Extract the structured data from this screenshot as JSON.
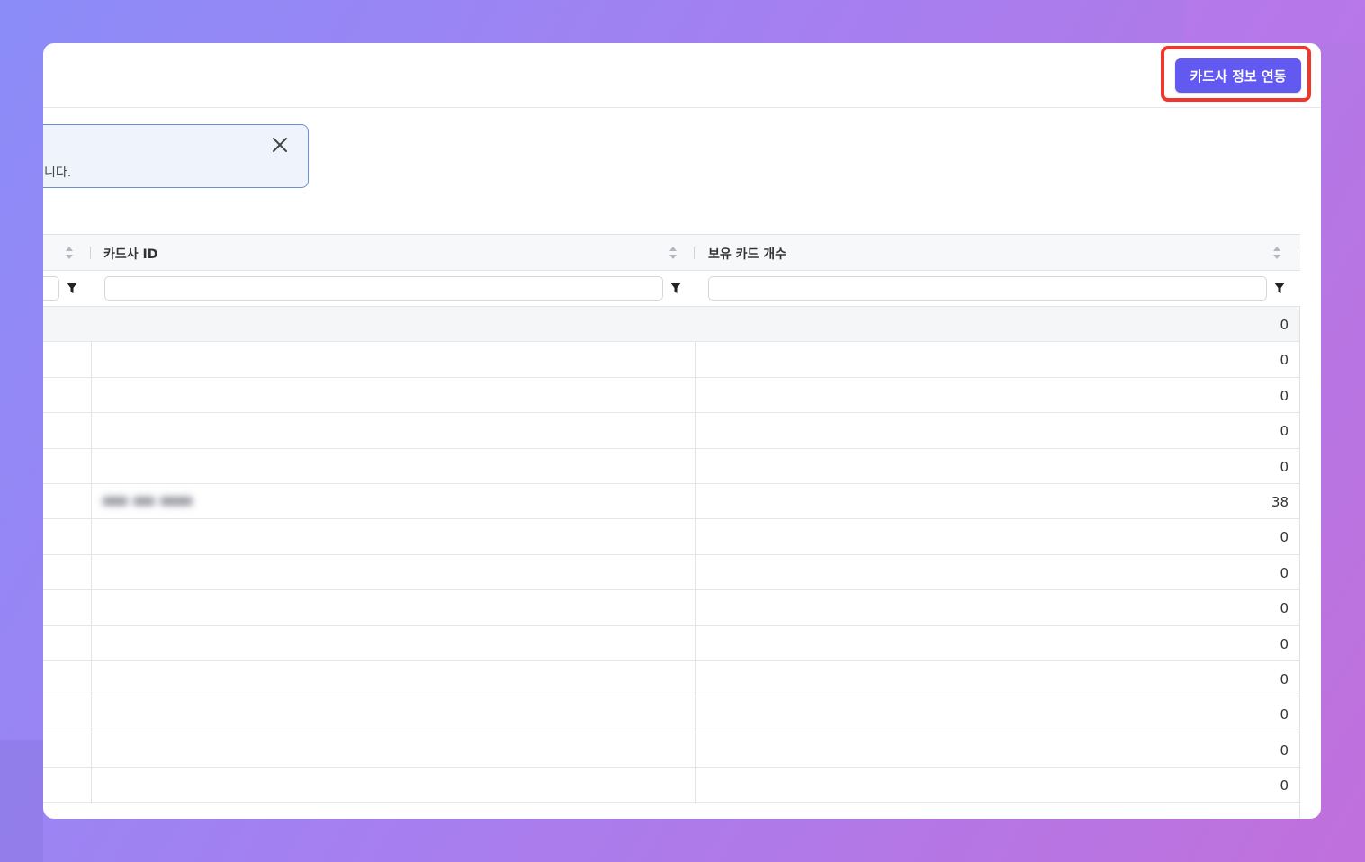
{
  "header": {
    "primary_button_label": "카드사 정보 연동"
  },
  "notice": {
    "text": "니다."
  },
  "table": {
    "columns": [
      {
        "label": ""
      },
      {
        "label": "카드사 ID"
      },
      {
        "label": "보유 카드 개수"
      }
    ],
    "rows": [
      {
        "card_count": "0"
      },
      {
        "card_count": "0"
      },
      {
        "card_count": "0"
      },
      {
        "card_count": "0"
      },
      {
        "card_count": "0"
      },
      {
        "card_count": "38"
      },
      {
        "card_count": "0"
      },
      {
        "card_count": "0"
      },
      {
        "card_count": "0"
      },
      {
        "card_count": "0"
      },
      {
        "card_count": "0"
      },
      {
        "card_count": "0"
      },
      {
        "card_count": "0"
      },
      {
        "card_count": "0"
      }
    ]
  },
  "icons": {
    "sort": "sort-icon",
    "filter": "filter-icon",
    "close": "close-icon"
  },
  "colors": {
    "primary": "#6259f0",
    "highlight": "#f2362b",
    "notice_border": "#6b8fd6"
  }
}
